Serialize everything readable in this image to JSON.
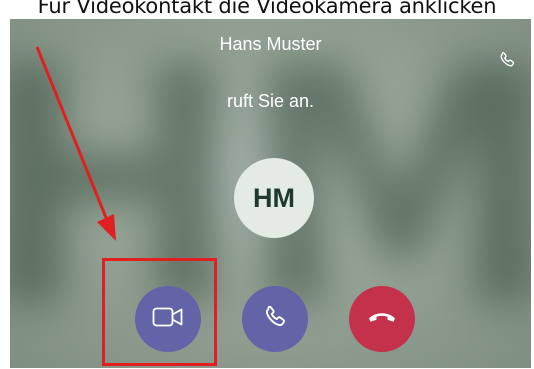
{
  "instruction": {
    "text": "Für Videokontakt die Videokamera anklicken"
  },
  "incoming_call": {
    "caller_name": "Hans Muster",
    "status": "ruft Sie an.",
    "avatar_initials": "HM",
    "background_monogram": "HM",
    "header_icon": "phone-icon"
  },
  "actions": [
    {
      "name": "accept-video",
      "icon": "video-camera-icon",
      "color": "#6264a7"
    },
    {
      "name": "accept-audio",
      "icon": "phone-icon",
      "color": "#6264a7"
    },
    {
      "name": "decline",
      "icon": "hang-up-icon",
      "color": "#c4314b"
    }
  ],
  "annotation": {
    "color": "#e02020",
    "target": "accept-video"
  }
}
